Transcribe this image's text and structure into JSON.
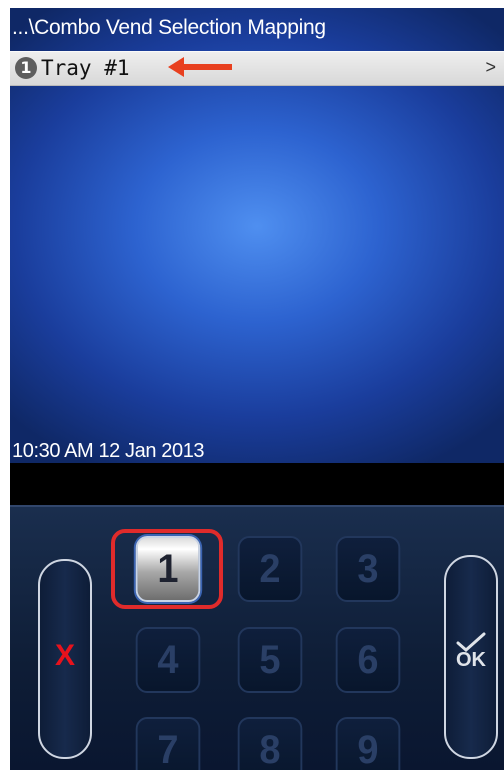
{
  "header": {
    "path_title": "...\\Combo Vend Selection Mapping"
  },
  "menu": {
    "item_badge": "1",
    "item_label": "Tray #1",
    "chevron": ">"
  },
  "status": {
    "datetime": "10:30 AM 12 Jan 2013"
  },
  "keypad": {
    "keys": [
      "1",
      "2",
      "3",
      "4",
      "5",
      "6",
      "7",
      "8",
      "9"
    ],
    "active_key": "1",
    "cancel_label": "X",
    "ok_label": "OK"
  },
  "colors": {
    "annotation_red": "#e02b2b",
    "cancel_red": "#e8121c",
    "screen_blue": "#2d63d0"
  },
  "icons": {
    "annotation_arrow": "arrow-left-icon",
    "ok_check": "check-icon"
  }
}
